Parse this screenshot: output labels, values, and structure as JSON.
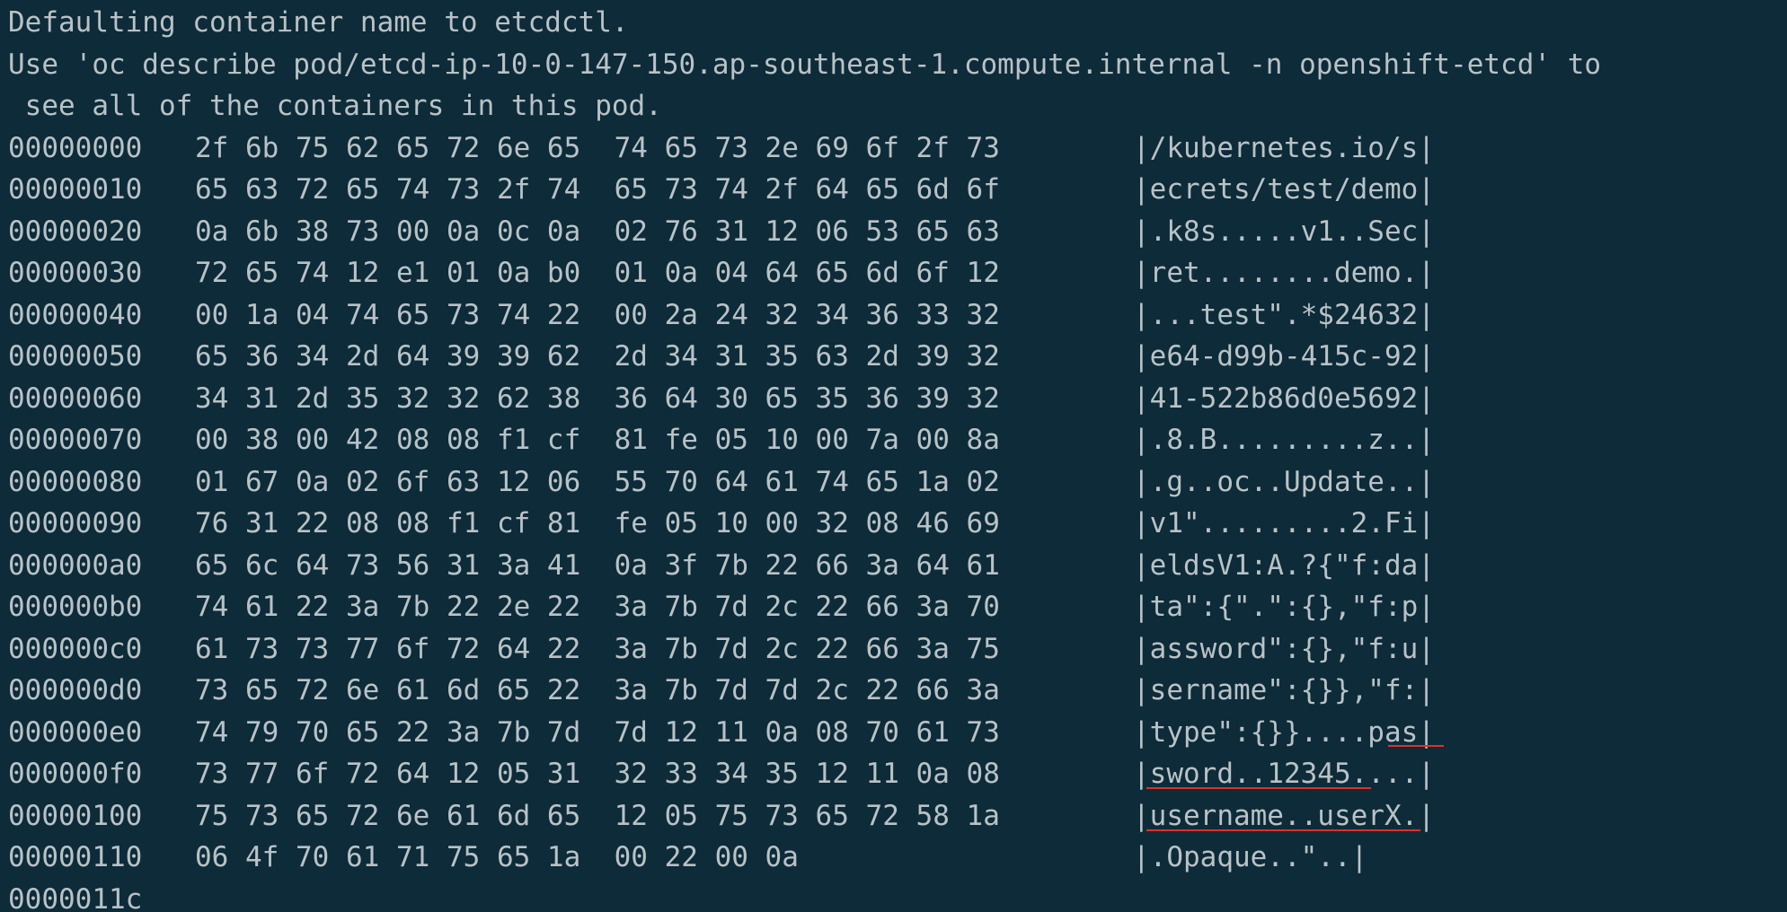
{
  "messages": [
    "Defaulting container name to etcdctl.",
    "Use 'oc describe pod/etcd-ip-10-0-147-150.ap-southeast-1.compute.internal -n openshift-etcd' to",
    " see all of the containers in this pod."
  ],
  "hexdump": [
    {
      "offset": "00000000",
      "hex": "2f 6b 75 62 65 72 6e 65  74 65 73 2e 69 6f 2f 73",
      "ascii": "|/kubernetes.io/s|"
    },
    {
      "offset": "00000010",
      "hex": "65 63 72 65 74 73 2f 74  65 73 74 2f 64 65 6d 6f",
      "ascii": "|ecrets/test/demo|"
    },
    {
      "offset": "00000020",
      "hex": "0a 6b 38 73 00 0a 0c 0a  02 76 31 12 06 53 65 63",
      "ascii": "|.k8s.....v1..Sec|"
    },
    {
      "offset": "00000030",
      "hex": "72 65 74 12 e1 01 0a b0  01 0a 04 64 65 6d 6f 12",
      "ascii": "|ret........demo.|"
    },
    {
      "offset": "00000040",
      "hex": "00 1a 04 74 65 73 74 22  00 2a 24 32 34 36 33 32",
      "ascii": "|...test\".*$24632|"
    },
    {
      "offset": "00000050",
      "hex": "65 36 34 2d 64 39 39 62  2d 34 31 35 63 2d 39 32",
      "ascii": "|e64-d99b-415c-92|"
    },
    {
      "offset": "00000060",
      "hex": "34 31 2d 35 32 32 62 38  36 64 30 65 35 36 39 32",
      "ascii": "|41-522b86d0e5692|"
    },
    {
      "offset": "00000070",
      "hex": "00 38 00 42 08 08 f1 cf  81 fe 05 10 00 7a 00 8a",
      "ascii": "|.8.B.........z..|"
    },
    {
      "offset": "00000080",
      "hex": "01 67 0a 02 6f 63 12 06  55 70 64 61 74 65 1a 02",
      "ascii": "|.g..oc..Update..|"
    },
    {
      "offset": "00000090",
      "hex": "76 31 22 08 08 f1 cf 81  fe 05 10 00 32 08 46 69",
      "ascii": "|v1\".........2.Fi|"
    },
    {
      "offset": "000000a0",
      "hex": "65 6c 64 73 56 31 3a 41  0a 3f 7b 22 66 3a 64 61",
      "ascii": "|eldsV1:A.?{\"f:da|"
    },
    {
      "offset": "000000b0",
      "hex": "74 61 22 3a 7b 22 2e 22  3a 7b 7d 2c 22 66 3a 70",
      "ascii": "|ta\":{\".\":{},\"f:p|"
    },
    {
      "offset": "000000c0",
      "hex": "61 73 73 77 6f 72 64 22  3a 7b 7d 2c 22 66 3a 75",
      "ascii": "|assword\":{},\"f:u|"
    },
    {
      "offset": "000000d0",
      "hex": "73 65 72 6e 61 6d 65 22  3a 7b 7d 7d 2c 22 66 3a",
      "ascii": "|sername\":{}},\"f:|"
    },
    {
      "offset": "000000e0",
      "hex": "74 79 70 65 22 3a 7b 7d  7d 12 11 0a 08 70 61 73",
      "ascii": "|type\":{}}....pas|"
    },
    {
      "offset": "000000f0",
      "hex": "73 77 6f 72 64 12 05 31  32 33 34 35 12 11 0a 08",
      "ascii": "|sword..12345....|"
    },
    {
      "offset": "00000100",
      "hex": "75 73 65 72 6e 61 6d 65  12 05 75 73 65 72 58 1a",
      "ascii": "|username..userX.|"
    },
    {
      "offset": "00000110",
      "hex": "06 4f 70 61 71 75 65 1a  00 22 00 0a",
      "ascii": "|.Opaque..\"..|"
    }
  ],
  "final_offset": "0000011c",
  "colors": {
    "background": "#0d2b39",
    "text": "#b9c2c6",
    "annotation": "#e0302a"
  }
}
